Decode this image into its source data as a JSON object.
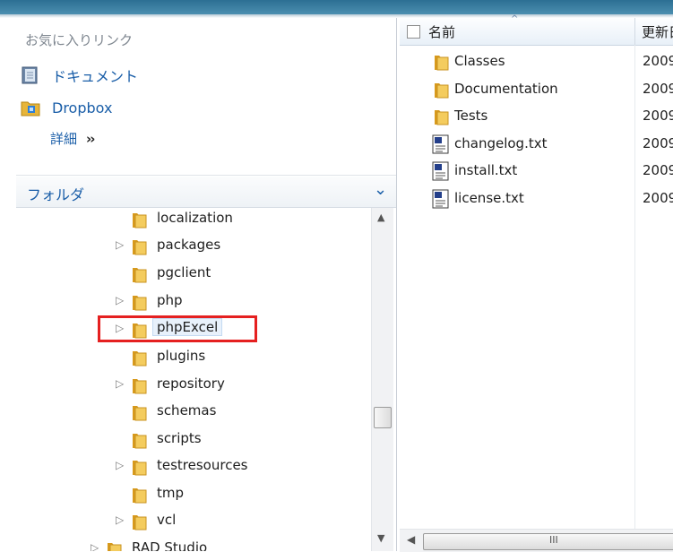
{
  "favorites": {
    "header": "お気に入りリンク",
    "items": [
      {
        "label": "ドキュメント",
        "icon": "documents-icon"
      },
      {
        "label": "Dropbox",
        "icon": "dropbox-folder-icon"
      }
    ],
    "details_label": "詳細",
    "details_arrows": "»"
  },
  "folders": {
    "header": "フォルダ",
    "collapse_glyph": "⌄",
    "tree": [
      {
        "name": "localization",
        "expandable": false
      },
      {
        "name": "packages",
        "expandable": true
      },
      {
        "name": "pgclient",
        "expandable": false
      },
      {
        "name": "php",
        "expandable": true
      },
      {
        "name": "phpExcel",
        "expandable": true,
        "selected": true
      },
      {
        "name": "plugins",
        "expandable": false
      },
      {
        "name": "repository",
        "expandable": true
      },
      {
        "name": "schemas",
        "expandable": false
      },
      {
        "name": "scripts",
        "expandable": false
      },
      {
        "name": "testresources",
        "expandable": true
      },
      {
        "name": "tmp",
        "expandable": false
      },
      {
        "name": "vcl",
        "expandable": true
      },
      {
        "name": "RAD Studio",
        "expandable": true
      }
    ]
  },
  "file_list": {
    "columns": {
      "name": "名前",
      "modified": "更新日"
    },
    "files": [
      {
        "name": "Classes",
        "type": "folder",
        "date": "2009"
      },
      {
        "name": "Documentation",
        "type": "folder",
        "date": "2009"
      },
      {
        "name": "Tests",
        "type": "folder",
        "date": "2009"
      },
      {
        "name": "changelog.txt",
        "type": "text",
        "date": "2009"
      },
      {
        "name": "install.txt",
        "type": "text",
        "date": "2009"
      },
      {
        "name": "license.txt",
        "type": "text",
        "date": "2009"
      }
    ]
  },
  "scroll": {
    "h_grip": "III"
  },
  "colors": {
    "accent": "#1a5ea8",
    "highlight": "#e52020",
    "titlebar": "#2c6f93"
  }
}
